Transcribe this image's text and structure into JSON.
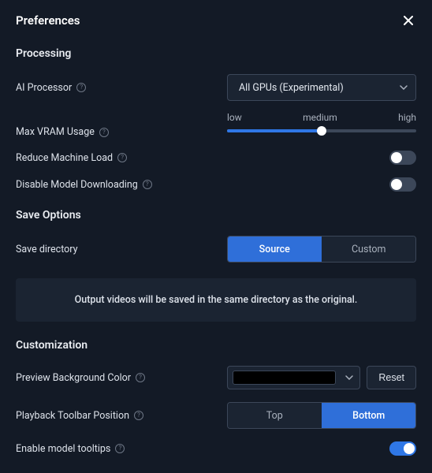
{
  "header": {
    "title": "Preferences"
  },
  "sections": {
    "processing": {
      "title": "Processing",
      "ai_processor": {
        "label": "AI Processor",
        "value": "All GPUs (Experimental)"
      },
      "max_vram": {
        "label": "Max VRAM Usage",
        "marks": {
          "low": "low",
          "medium": "medium",
          "high": "high"
        },
        "value": "medium"
      },
      "reduce_load": {
        "label": "Reduce Machine Load",
        "on": false
      },
      "disable_download": {
        "label": "Disable Model Downloading",
        "on": false
      }
    },
    "save": {
      "title": "Save Options",
      "save_dir": {
        "label": "Save directory",
        "options": {
          "source": "Source",
          "custom": "Custom"
        },
        "active": "source"
      },
      "info": "Output videos will be saved in the same directory as the original."
    },
    "custom": {
      "title": "Customization",
      "bg_color": {
        "label": "Preview Background Color",
        "value": "#000000",
        "reset": "Reset"
      },
      "toolbar_pos": {
        "label": "Playback Toolbar Position",
        "options": {
          "top": "Top",
          "bottom": "Bottom"
        },
        "active": "bottom"
      },
      "tooltips": {
        "label": "Enable model tooltips",
        "on": true
      }
    }
  }
}
